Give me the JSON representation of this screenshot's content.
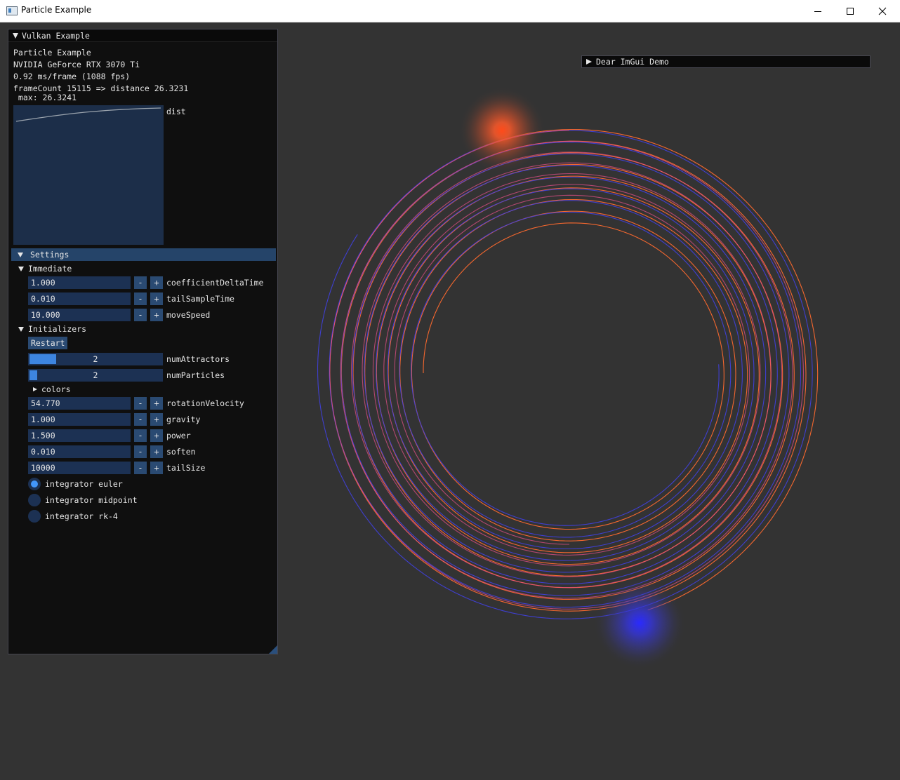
{
  "window": {
    "title": "Particle Example"
  },
  "panel": {
    "title": "Vulkan Example",
    "app_name": "Particle Example",
    "gpu": "NVIDIA GeForce RTX 3070 Ti",
    "frame_time": "0.92 ms/frame (1088 fps)",
    "frame_info": "frameCount 15115 => distance 26.3231",
    "plot_overlay": " max: 26.3241",
    "plot_label": "dist",
    "settings_header": "Settings",
    "immediate": {
      "label": "Immediate",
      "fields": [
        {
          "value": "1.000",
          "label": "coefficientDeltaTime"
        },
        {
          "value": "0.010",
          "label": "tailSampleTime"
        },
        {
          "value": "10.000",
          "label": "moveSpeed"
        }
      ]
    },
    "initializers": {
      "label": "Initializers",
      "restart_label": "Restart",
      "sliders": [
        {
          "value": "2",
          "label": "numAttractors"
        },
        {
          "value": "2",
          "label": "numParticles"
        }
      ],
      "colors_label": "colors",
      "fields": [
        {
          "value": "54.770",
          "label": "rotationVelocity"
        },
        {
          "value": "1.000",
          "label": "gravity"
        },
        {
          "value": "1.500",
          "label": "power"
        },
        {
          "value": "0.010",
          "label": "soften"
        },
        {
          "value": "10000",
          "label": "tailSize"
        }
      ],
      "radios": [
        {
          "label": "integrator euler",
          "selected": true
        },
        {
          "label": "integrator midpoint",
          "selected": false
        },
        {
          "label": "integrator rk-4",
          "selected": false
        }
      ]
    },
    "minus_label": "-",
    "plus_label": "+"
  },
  "demo_window": {
    "title": "Dear ImGui Demo"
  },
  "colors": {
    "background": "#333333",
    "attractor_orange": "#ff5a2a",
    "attractor_blue": "#3a3ae0",
    "trail_orange": "#ff6a2e",
    "trail_blue": "#4040e0",
    "trail_pink": "#e8508a",
    "imgui_frame": "#1c3153",
    "imgui_button": "#2a4a72",
    "imgui_accent": "#4296fa"
  }
}
